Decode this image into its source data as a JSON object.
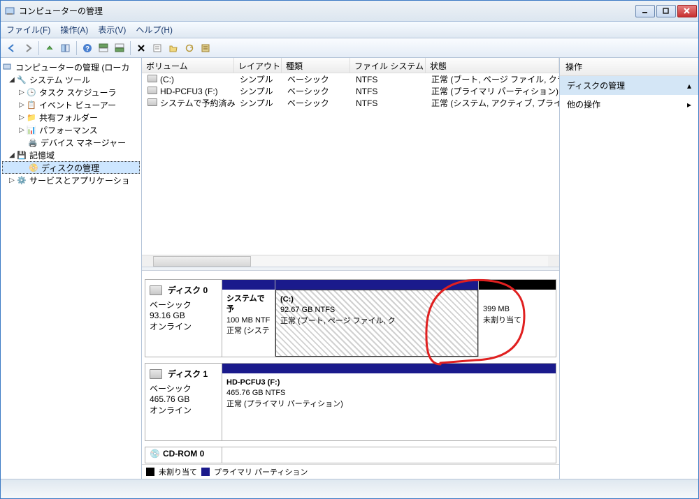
{
  "window": {
    "title": "コンピューターの管理"
  },
  "menu": {
    "file": "ファイル(F)",
    "action": "操作(A)",
    "view": "表示(V)",
    "help": "ヘルプ(H)"
  },
  "tree": {
    "root": "コンピューターの管理 (ローカ",
    "systools": "システム ツール",
    "task": "タスク スケジューラ",
    "event": "イベント ビューアー",
    "shared": "共有フォルダー",
    "perf": "パフォーマンス",
    "devmgr": "デバイス マネージャー",
    "storage": "記憶域",
    "diskmgmt": "ディスクの管理",
    "svcapp": "サービスとアプリケーショ"
  },
  "cols": {
    "volume": "ボリューム",
    "layout": "レイアウト",
    "type": "種類",
    "fs": "ファイル システム",
    "status": "状態"
  },
  "vols": [
    {
      "name": "(C:)",
      "layout": "シンプル",
      "type": "ベーシック",
      "fs": "NTFS",
      "status": "正常 (ブート, ページ ファイル, クラ"
    },
    {
      "name": "HD-PCFU3 (F:)",
      "layout": "シンプル",
      "type": "ベーシック",
      "fs": "NTFS",
      "status": "正常 (プライマリ パーティション)"
    },
    {
      "name": "システムで予約済み",
      "layout": "シンプル",
      "type": "ベーシック",
      "fs": "NTFS",
      "status": "正常 (システム, アクティブ, プライ"
    }
  ],
  "disks": {
    "d0": {
      "label": "ディスク 0",
      "kind": "ベーシック",
      "size": "93.16 GB",
      "state": "オンライン",
      "p0": {
        "title": "システムで予",
        "line2": "100 MB NTF",
        "line3": "正常 (システ"
      },
      "p1": {
        "title": " (C:)",
        "line2": "92.67 GB NTFS",
        "line3": "正常 (ブート, ページ ファイル, ク"
      },
      "p2": {
        "line2": "399 MB",
        "line3": "未割り当て"
      }
    },
    "d1": {
      "label": "ディスク 1",
      "kind": "ベーシック",
      "size": "465.76 GB",
      "state": "オンライン",
      "p0": {
        "title": "HD-PCFU3  (F:)",
        "line2": "465.76 GB NTFS",
        "line3": "正常 (プライマリ パーティション)"
      }
    },
    "cd": {
      "label": "CD-ROM 0"
    }
  },
  "legend": {
    "unalloc": "未割り当て",
    "primary": "プライマリ パーティション"
  },
  "actions": {
    "header": "操作",
    "diskmgmt": "ディスクの管理",
    "other": "他の操作"
  }
}
